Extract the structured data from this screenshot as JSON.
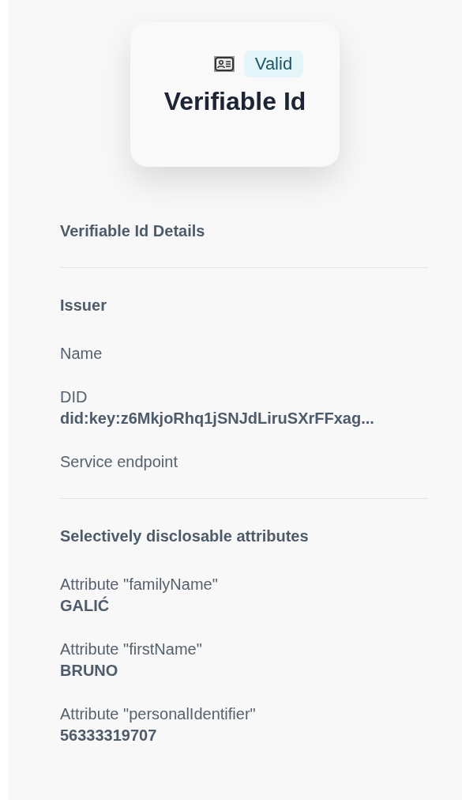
{
  "card": {
    "status": "Valid",
    "title": "Verifiable Id"
  },
  "sections": [
    {
      "heading": "Verifiable Id Details"
    },
    {
      "heading": "Issuer",
      "fields": [
        {
          "label": "Name"
        },
        {
          "label": "DID",
          "value": "did:key:z6MkjoRhq1jSNJdLiruSXrFFxag..."
        },
        {
          "label": "Service endpoint"
        }
      ]
    },
    {
      "heading": "Selectively disclosable attributes",
      "fields": [
        {
          "label": "Attribute \"familyName\"",
          "value": "GALIĆ"
        },
        {
          "label": "Attribute \"firstName\"",
          "value": "BRUNO"
        },
        {
          "label": "Attribute \"personalIdentifier\"",
          "value": "56333319707"
        }
      ]
    }
  ]
}
